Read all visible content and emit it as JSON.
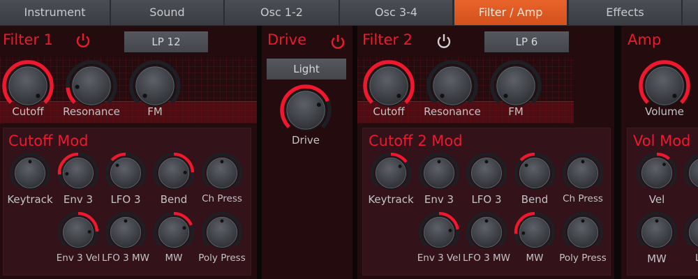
{
  "tabs": [
    {
      "label": "Instrument"
    },
    {
      "label": "Sound"
    },
    {
      "label": "Osc 1-2"
    },
    {
      "label": "Osc 3-4"
    },
    {
      "label": "Filter / Amp",
      "active": true
    },
    {
      "label": "Effects"
    },
    {
      "label": ""
    }
  ],
  "colors": {
    "accent": "#f0182e",
    "active_tab": "#e05a20",
    "power_off": "#cfd0d2"
  },
  "filter1": {
    "title": "Filter 1",
    "power": true,
    "type": "LP 12",
    "knobs": [
      {
        "label": "Cutoff",
        "value": 1.0
      },
      {
        "label": "Resonance",
        "value": 0.15
      },
      {
        "label": "FM",
        "value": 0.0
      }
    ],
    "mod": {
      "title": "Cutoff Mod",
      "knobs": [
        {
          "label": "Keytrack",
          "value": 0
        },
        {
          "label": "Env 3",
          "value": -0.7
        },
        {
          "label": "LFO 3",
          "value": -0.35
        },
        {
          "label": "Bend",
          "value": 0.65
        },
        {
          "label": "Ch Press",
          "value": 0
        },
        {
          "label": "Env 3 Vel",
          "value": 0.65
        },
        {
          "label": "LFO 3 MW",
          "value": 0
        },
        {
          "label": "MW",
          "value": 0.5
        },
        {
          "label": "Poly Press",
          "value": 0
        }
      ]
    }
  },
  "drive": {
    "title": "Drive",
    "power": true,
    "type": "Light",
    "knob": {
      "label": "Drive",
      "value": 0.75
    }
  },
  "filter2": {
    "title": "Filter 2",
    "power": false,
    "type": "LP 6",
    "knobs": [
      {
        "label": "Cutoff",
        "value": 1.0
      },
      {
        "label": "Resonance",
        "value": 0.0
      },
      {
        "label": "FM",
        "value": 0.0
      }
    ],
    "mod": {
      "title": "Cutoff 2 Mod",
      "knobs": [
        {
          "label": "Keytrack",
          "value": 0.4
        },
        {
          "label": "Env 3",
          "value": 0
        },
        {
          "label": "LFO 3",
          "value": 0
        },
        {
          "label": "Bend",
          "value": -0.35
        },
        {
          "label": "Ch Press",
          "value": 0
        },
        {
          "label": "Env 3 Vel",
          "value": 0.6
        },
        {
          "label": "LFO 3 MW",
          "value": 0
        },
        {
          "label": "MW",
          "value": -0.7
        },
        {
          "label": "Poly Press",
          "value": 0
        }
      ]
    }
  },
  "amp": {
    "title": "Amp",
    "knob": {
      "label": "Volume",
      "value": 1.0
    },
    "mod": {
      "title": "Vol Mod",
      "knobs": [
        {
          "label": "Vel",
          "value": 0.3
        },
        {
          "label": "LF",
          "value": 0
        },
        {
          "label": "MW",
          "value": 0
        },
        {
          "label": "LFO",
          "value": 0
        }
      ]
    }
  }
}
